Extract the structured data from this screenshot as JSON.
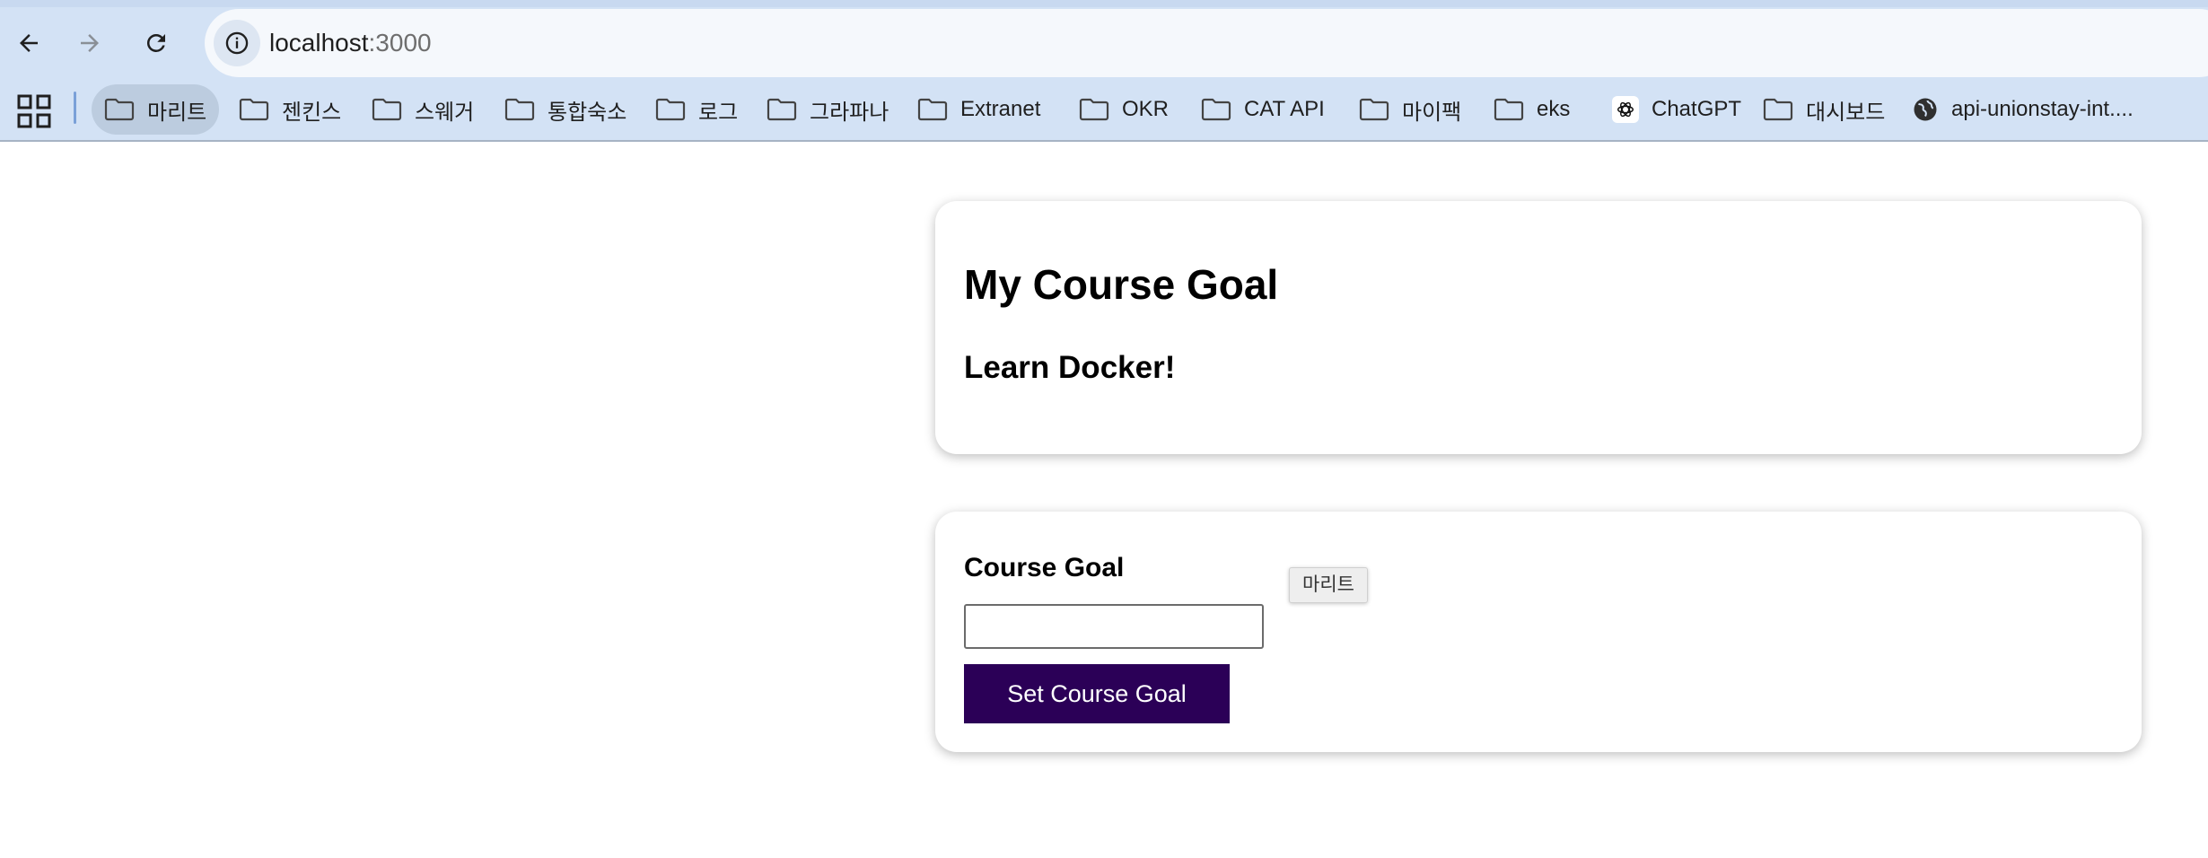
{
  "browser": {
    "url_host": "localhost",
    "url_port": ":3000",
    "bookmarks": [
      {
        "label": "마리트",
        "icon": "folder-icon"
      },
      {
        "label": "젠킨스",
        "icon": "folder-icon"
      },
      {
        "label": "스웨거",
        "icon": "folder-icon"
      },
      {
        "label": "통합숙소",
        "icon": "folder-icon"
      },
      {
        "label": "로그",
        "icon": "folder-icon"
      },
      {
        "label": "그라파나",
        "icon": "folder-icon"
      },
      {
        "label": "Extranet",
        "icon": "folder-icon"
      },
      {
        "label": "OKR",
        "icon": "folder-icon"
      },
      {
        "label": "CAT API",
        "icon": "folder-icon"
      },
      {
        "label": "마이팩",
        "icon": "folder-icon"
      },
      {
        "label": "eks",
        "icon": "folder-icon"
      },
      {
        "label": "ChatGPT",
        "icon": "chatgpt-icon"
      },
      {
        "label": "대시보드",
        "icon": "folder-icon"
      },
      {
        "label": "api-unionstay-int....",
        "icon": "globe-icon"
      }
    ],
    "tooltip": "마리트"
  },
  "page": {
    "title": "My Course Goal",
    "current_goal": "Learn Docker!",
    "form": {
      "label": "Course Goal",
      "input_value": "",
      "submit_label": "Set Course Goal"
    }
  },
  "colors": {
    "chrome_bg": "#d3e2f5",
    "button_bg": "#2b0057"
  }
}
